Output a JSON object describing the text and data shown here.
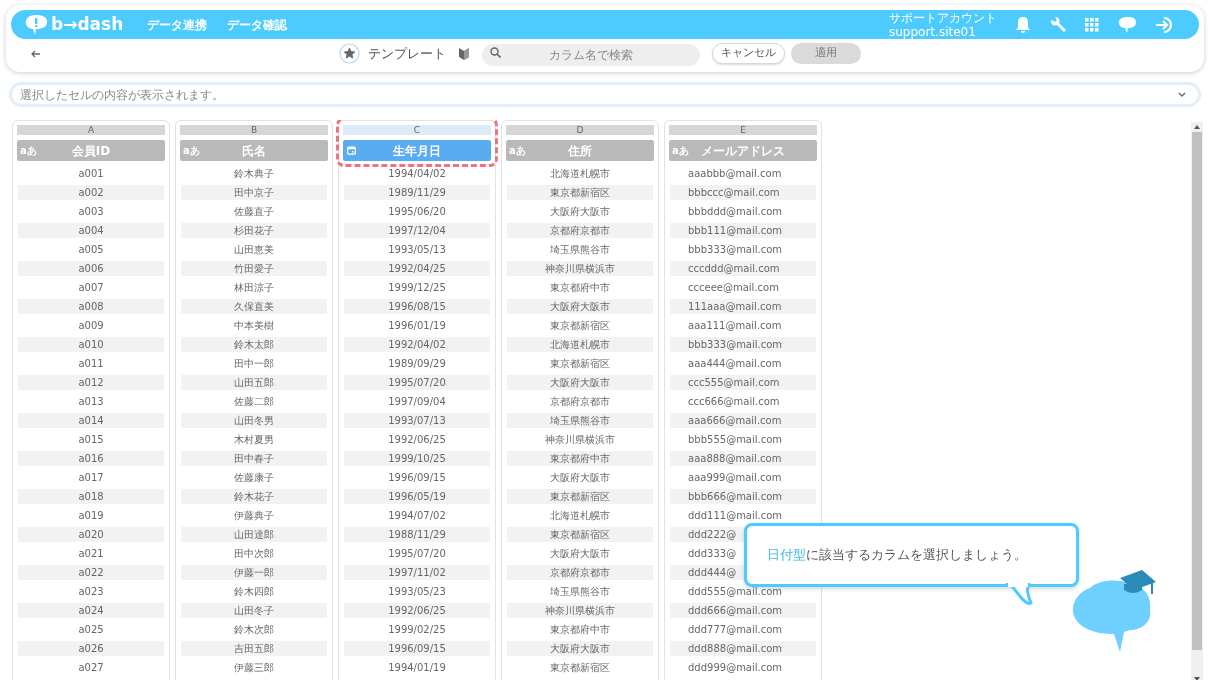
{
  "header": {
    "logo": "b→dash",
    "nav": [
      "データ連携",
      "データ確認"
    ],
    "account_name": "サポートアカウント",
    "account_id": "support.site01"
  },
  "toolbar": {
    "title": "テンプレート",
    "favorite": true,
    "search_placeholder": "カラム名で検索",
    "cancel": "キャンセル",
    "apply": "適用",
    "apply_disabled": true
  },
  "cell_preview": {
    "placeholder": "選択したセルの内容が表示されます。"
  },
  "columns": [
    {
      "letter": "A",
      "name": "会員ID",
      "kind": "text",
      "type_label": "aあ",
      "selected": false
    },
    {
      "letter": "B",
      "name": "氏名",
      "kind": "text",
      "type_label": "aあ",
      "selected": false
    },
    {
      "letter": "C",
      "name": "生年月日",
      "kind": "date",
      "selected": true
    },
    {
      "letter": "D",
      "name": "住所",
      "kind": "text",
      "type_label": "aあ",
      "selected": false
    },
    {
      "letter": "E",
      "name": "メールアドレス",
      "kind": "text",
      "type_label": "aあ",
      "selected": false
    }
  ],
  "rows": [
    [
      "a001",
      "鈴木典子",
      "1994/04/02",
      "北海道札幌市",
      "aaabbb@mail.com"
    ],
    [
      "a002",
      "田中京子",
      "1989/11/29",
      "東京都新宿区",
      "bbbccc@mail.com"
    ],
    [
      "a003",
      "佐藤直子",
      "1995/06/20",
      "大阪府大阪市",
      "bbbddd@mail.com"
    ],
    [
      "a004",
      "杉田花子",
      "1997/12/04",
      "京都府京都市",
      "bbb111@mail.com"
    ],
    [
      "a005",
      "山田恵美",
      "1993/05/13",
      "埼玉県熊谷市",
      "bbb333@mail.com"
    ],
    [
      "a006",
      "竹田愛子",
      "1992/04/25",
      "神奈川県横浜市",
      "cccddd@mail.com"
    ],
    [
      "a007",
      "林田涼子",
      "1999/12/25",
      "東京都府中市",
      "ccceee@mail.com"
    ],
    [
      "a008",
      "久保直美",
      "1996/08/15",
      "大阪府大阪市",
      "111aaa@mail.com"
    ],
    [
      "a009",
      "中本美樹",
      "1996/01/19",
      "東京都新宿区",
      "aaa111@mail.com"
    ],
    [
      "a010",
      "鈴木太郎",
      "1992/04/02",
      "北海道札幌市",
      "bbb333@mail.com"
    ],
    [
      "a011",
      "田中一郎",
      "1989/09/29",
      "東京都新宿区",
      "aaa444@mail.com"
    ],
    [
      "a012",
      "山田五郎",
      "1995/07/20",
      "大阪府大阪市",
      "ccc555@mail.com"
    ],
    [
      "a013",
      "佐藤二郎",
      "1997/09/04",
      "京都府京都市",
      "ccc666@mail.com"
    ],
    [
      "a014",
      "山田冬男",
      "1993/07/13",
      "埼玉県熊谷市",
      "aaa666@mail.com"
    ],
    [
      "a015",
      "木村夏男",
      "1992/06/25",
      "神奈川県横浜市",
      "bbb555@mail.com"
    ],
    [
      "a016",
      "田中春子",
      "1999/10/25",
      "東京都府中市",
      "aaa888@mail.com"
    ],
    [
      "a017",
      "佐藤康子",
      "1996/09/15",
      "大阪府大阪市",
      "aaa999@mail.com"
    ],
    [
      "a018",
      "鈴木花子",
      "1996/05/19",
      "東京都新宿区",
      "bbb666@mail.com"
    ],
    [
      "a019",
      "伊藤典子",
      "1994/07/02",
      "北海道札幌市",
      "ddd111@mail.com"
    ],
    [
      "a020",
      "山田達郎",
      "1988/11/29",
      "東京都新宿区",
      "ddd222@"
    ],
    [
      "a021",
      "田中次郎",
      "1995/07/20",
      "大阪府大阪市",
      "ddd333@"
    ],
    [
      "a022",
      "伊藤一郎",
      "1997/11/02",
      "京都府京都市",
      "ddd444@"
    ],
    [
      "a023",
      "鈴木四郎",
      "1993/05/23",
      "埼玉県熊谷市",
      "ddd555@mail.com"
    ],
    [
      "a024",
      "山田冬子",
      "1992/06/25",
      "神奈川県横浜市",
      "ddd666@mail.com"
    ],
    [
      "a025",
      "鈴木次郎",
      "1999/02/25",
      "東京都府中市",
      "ddd777@mail.com"
    ],
    [
      "a026",
      "吉田五郎",
      "1996/09/15",
      "大阪府大阪市",
      "ddd888@mail.com"
    ],
    [
      "a027",
      "伊藤三郎",
      "1994/01/19",
      "東京都新宿区",
      "ddd999@mail.com"
    ]
  ],
  "hint": {
    "text": "**日付型**に該当するカラムを選択しましょう。"
  }
}
